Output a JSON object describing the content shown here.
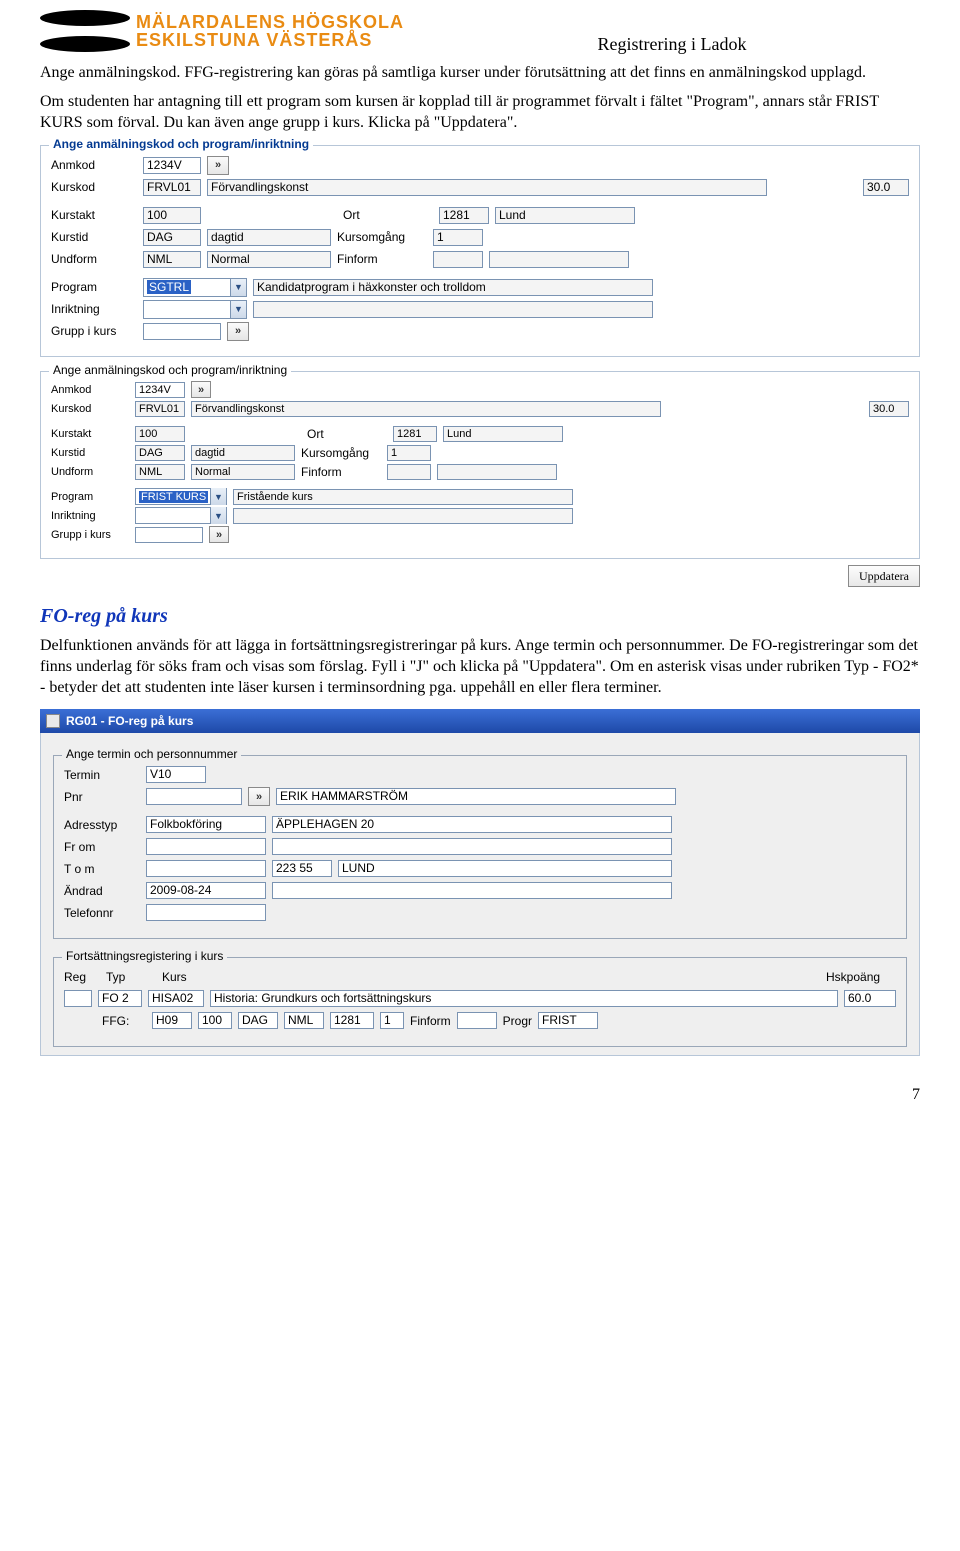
{
  "header": {
    "logo_line1": "MÄLARDALENS HÖGSKOLA",
    "logo_line2": "ESKILSTUNA VÄSTERÅS",
    "doc_title": "Registrering i Ladok"
  },
  "intro": {
    "p1": "Ange anmälningskod. FFG-registrering kan göras på samtliga kurser under förutsättning att det finns en anmälningskod upplagd.",
    "p2": "Om studenten har antagning till ett program som kursen är kopplad till är programmet förvalt i fältet \"Program\", annars står FRIST KURS som förval. Du kan även ange grupp i kurs. Klicka på \"Uppdatera\"."
  },
  "form1": {
    "legend": "Ange anmälningskod och program/inriktning",
    "anmkod_lbl": "Anmkod",
    "anmkod": "1234V",
    "kurskod_lbl": "Kurskod",
    "kurskod": "FRVL01",
    "kursnamn": "Förvandlingskonst",
    "points": "30.0",
    "kurstakt_lbl": "Kurstakt",
    "kurstakt": "100",
    "kurstid_lbl": "Kurstid",
    "kurstid": "DAG",
    "kurstid_desc": "dagtid",
    "undform_lbl": "Undform",
    "undform": "NML",
    "undform_desc": "Normal",
    "ort_lbl": "Ort",
    "ort": "1281",
    "ort_name": "Lund",
    "komg_lbl": "Kursomgång",
    "komg": "1",
    "finform_lbl": "Finform",
    "program_lbl": "Program",
    "program_sel": "SGTRL",
    "program_desc": "Kandidatprogram i häxkonster och trolldom",
    "inrikt_lbl": "Inriktning",
    "grupp_lbl": "Grupp i kurs"
  },
  "form2": {
    "legend": "Ange anmälningskod och program/inriktning",
    "anmkod_lbl": "Anmkod",
    "anmkod": "1234V",
    "kurskod_lbl": "Kurskod",
    "kurskod": "FRVL01",
    "kursnamn": "Förvandlingskonst",
    "points": "30.0",
    "kurstakt_lbl": "Kurstakt",
    "kurstakt": "100",
    "kurstid_lbl": "Kurstid",
    "kurstid": "DAG",
    "kurstid_desc": "dagtid",
    "undform_lbl": "Undform",
    "undform": "NML",
    "undform_desc": "Normal",
    "ort_lbl": "Ort",
    "ort": "1281",
    "ort_name": "Lund",
    "komg_lbl": "Kursomgång",
    "komg": "1",
    "finform_lbl": "Finform",
    "program_lbl": "Program",
    "program_sel": "FRIST KURS",
    "program_desc": "Fristående kurs",
    "inrikt_lbl": "Inriktning",
    "grupp_lbl": "Grupp i kurs",
    "update_btn": "Uppdatera"
  },
  "section2": {
    "heading": "FO-reg på kurs",
    "p1": "Delfunktionen används för att lägga in fortsättningsregistreringar på kurs. Ange termin och personnummer. De FO-registreringar som det finns underlag för söks fram och visas som förslag. Fyll i \"J\" och klicka på \"Uppdatera\". Om en asterisk visas under rubriken Typ - FO2* - betyder det att studenten inte läser kursen i terminsordning pga. uppehåll en eller flera terminer."
  },
  "win": {
    "title": "RG01 - FO-reg på kurs",
    "box1": {
      "legend": "Ange termin och personnummer",
      "termin_lbl": "Termin",
      "termin": "V10",
      "pnr_lbl": "Pnr",
      "pnr": "",
      "namn": "ERIK HAMMARSTRÖM",
      "adresstyp_lbl": "Adresstyp",
      "adresstyp": "Folkbokföring",
      "adress": "ÄPPLEHAGEN 20",
      "from_lbl": "Fr om",
      "tom_lbl": "T o m",
      "tom_zip": "223 55",
      "tom_city": "LUND",
      "andrad_lbl": "Ändrad",
      "andrad": "2009-08-24",
      "tel_lbl": "Telefonnr"
    },
    "box2": {
      "legend": "Fortsättningsregistering i kurs",
      "h_reg": "Reg",
      "h_typ": "Typ",
      "h_kurs": "Kurs",
      "h_hp": "Hskpoäng",
      "typ": "FO 2",
      "kurskod": "HISA02",
      "kursnamn": "Historia: Grundkurs och fortsättningskurs",
      "hp": "60.0",
      "ffg_lbl": "FFG:",
      "ffg_termin": "H09",
      "ffg_takt": "100",
      "ffg_tid": "DAG",
      "ffg_form": "NML",
      "ffg_ort": "1281",
      "ffg_omg": "1",
      "ff_label": "Finform",
      "progr_lbl": "Progr",
      "progr": "FRIST"
    }
  },
  "page_num": "7"
}
